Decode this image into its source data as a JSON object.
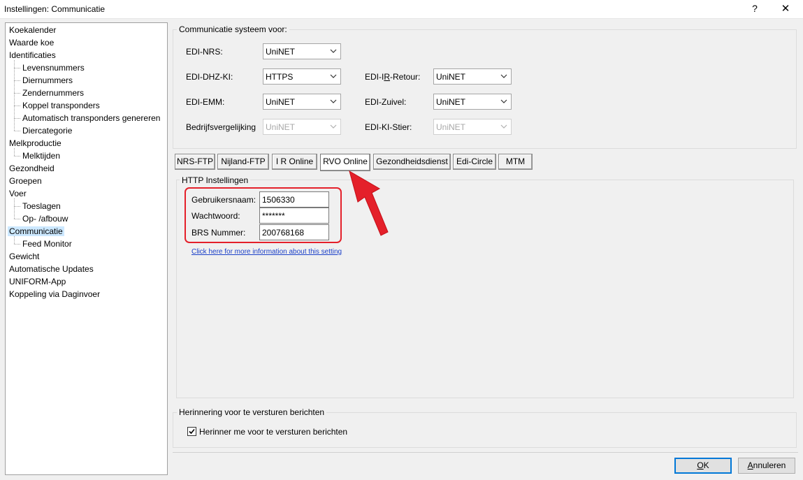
{
  "window": {
    "title": "Instellingen:  Communicatie",
    "help_label": "?",
    "close_label": "✕"
  },
  "sidebar": {
    "items": [
      {
        "label": "Koekalender",
        "level": 0
      },
      {
        "label": "Waarde koe",
        "level": 0
      },
      {
        "label": "Identificaties",
        "level": 0
      },
      {
        "label": "Levensnummers",
        "level": 1
      },
      {
        "label": "Diernummers",
        "level": 1
      },
      {
        "label": "Zendernummers",
        "level": 1
      },
      {
        "label": "Koppel transponders",
        "level": 1
      },
      {
        "label": "Automatisch transponders genereren",
        "level": 1
      },
      {
        "label": "Diercategorie",
        "level": 1
      },
      {
        "label": "Melkproductie",
        "level": 0
      },
      {
        "label": "Melktijden",
        "level": 1
      },
      {
        "label": "Gezondheid",
        "level": 0
      },
      {
        "label": "Groepen",
        "level": 0
      },
      {
        "label": "Voer",
        "level": 0
      },
      {
        "label": "Toeslagen",
        "level": 1
      },
      {
        "label": "Op- /afbouw",
        "level": 1
      },
      {
        "label": "Communicatie",
        "level": 0,
        "selected": true
      },
      {
        "label": "Feed Monitor",
        "level": 1
      },
      {
        "label": "Gewicht",
        "level": 0
      },
      {
        "label": "Automatische Updates",
        "level": 0
      },
      {
        "label": "UNIFORM-App",
        "level": 0
      },
      {
        "label": "Koppeling via Daginvoer",
        "level": 0
      }
    ]
  },
  "comm_system": {
    "group_title": "Communicatie systeem voor:",
    "edi_nrs": {
      "label": "EDI-NRS:",
      "value": "UniNET"
    },
    "edi_dhz_ki": {
      "label": "EDI-DHZ-KI:",
      "value": "HTTPS"
    },
    "edi_ir_retour": {
      "label_pre": "EDI-I",
      "label_ul": "R",
      "label_post": "-Retour:",
      "value": "UniNET"
    },
    "edi_emm": {
      "label": "EDI-EMM:",
      "value": "UniNET"
    },
    "edi_zuivel": {
      "label": "EDI-Zuivel:",
      "value": "UniNET"
    },
    "bedrijfsvergelijking": {
      "label": "Bedrijfsvergelijking",
      "value": "UniNET",
      "disabled": true
    },
    "edi_ki_stier": {
      "label": "EDI-KI-Stier:",
      "value": "UniNET",
      "disabled": true
    }
  },
  "tabs": [
    {
      "label": "NRS-FTP"
    },
    {
      "label": "Nijland-FTP"
    },
    {
      "label": "I  R Online"
    },
    {
      "label": "RVO Online",
      "active": true
    },
    {
      "label": "Gezondheidsdienst"
    },
    {
      "label": "Edi-Circle"
    },
    {
      "label": "MTM"
    }
  ],
  "http": {
    "group_title": "HTTP Instellingen",
    "username_label": "Gebruikersnaam:",
    "username_value": "1506330",
    "password_label": "Wachtwoord:",
    "password_value": "*******",
    "brs_label": "BRS Nummer:",
    "brs_value": "200768168",
    "info_link": "Click here for more information about this setting"
  },
  "reminder": {
    "group_title": "Herinnering voor te versturen berichten",
    "checkbox_label": "Herinner me voor te versturen berichten",
    "checked": true
  },
  "buttons": {
    "ok_ul": "O",
    "ok_rest": "K",
    "cancel_ul": "A",
    "cancel_rest": "nnuleren"
  },
  "colors": {
    "highlight": "#e4202a",
    "selection": "#cce8ff",
    "link": "#1a3fc8"
  }
}
